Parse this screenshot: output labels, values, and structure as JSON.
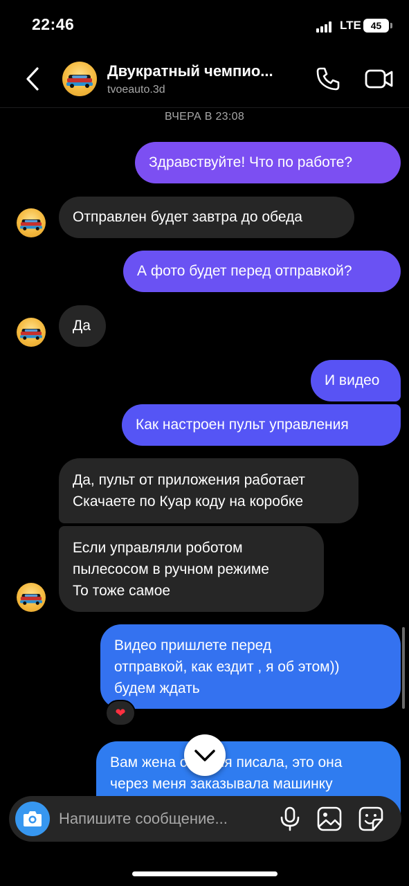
{
  "status_bar": {
    "time": "22:46",
    "network": "LTE",
    "battery": "45"
  },
  "header": {
    "title": "Двукратный чемпио...",
    "username": "tvoeauto.3d"
  },
  "date_separator": "ВЧЕРА В 23:08",
  "messages": [
    {
      "direction": "outgoing",
      "text": "Здравствуйте! Что по работе?"
    },
    {
      "direction": "incoming",
      "text": "Отправлен будет завтра до обеда"
    },
    {
      "direction": "outgoing",
      "text": "А фото будет перед отправкой?"
    },
    {
      "direction": "incoming",
      "text": "Да"
    },
    {
      "direction": "outgoing",
      "text": "И видео"
    },
    {
      "direction": "outgoing",
      "text": "Как настроен пульт управления"
    },
    {
      "direction": "incoming",
      "lines": [
        "Да, пульт от приложения работает",
        "Скачаете по Куар коду на коробке"
      ]
    },
    {
      "direction": "incoming",
      "lines": [
        "Если управляли роботом",
        "пылесосом в ручном режиме",
        "То тоже самое"
      ]
    },
    {
      "direction": "outgoing",
      "lines": [
        "Видео пришлете перед",
        "отправкой, как ездит , я об этом))",
        "будем ждать"
      ],
      "reaction": "❤"
    },
    {
      "direction": "outgoing",
      "lines": [
        "Вам жена сегодня писала, это она",
        "через меня заказывала машинку"
      ]
    }
  ],
  "composer": {
    "placeholder": "Напишите сообщение..."
  },
  "colors": {
    "outgoing_top": "#7b4ff2",
    "outgoing_mid": "#5254f5",
    "outgoing_bottom": "#3172f0",
    "incoming": "#262626",
    "accent": "#3797f0"
  },
  "icons": [
    "back-icon",
    "phone-icon",
    "video-call-icon",
    "camera-icon",
    "microphone-icon",
    "gallery-icon",
    "sticker-icon",
    "chevron-down-icon",
    "heart-icon"
  ]
}
